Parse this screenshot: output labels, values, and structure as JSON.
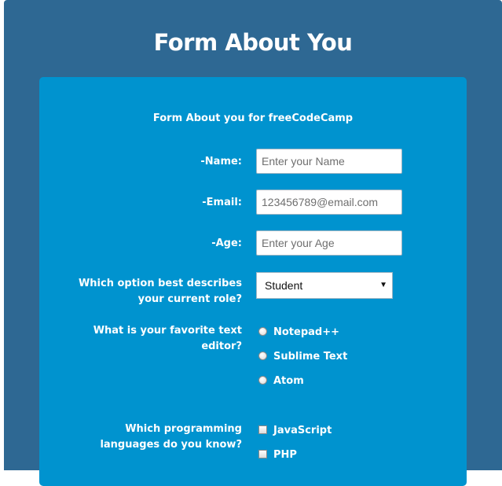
{
  "page": {
    "title": "Form About You"
  },
  "form": {
    "subtitle": "Form About you for freeCodeCamp",
    "name": {
      "label": "-Name:",
      "placeholder": "Enter your Name",
      "value": ""
    },
    "email": {
      "label": "-Email:",
      "placeholder": "123456789@email.com",
      "value": ""
    },
    "age": {
      "label": "-Age:",
      "placeholder": "Enter your Age",
      "value": ""
    },
    "role": {
      "label": "Which option best describes your current role?",
      "selected": "Student"
    },
    "editor": {
      "label": "What is your favorite text editor?",
      "options": [
        "Notepad++",
        "Sublime Text",
        "Atom"
      ]
    },
    "languages": {
      "label": "Which programming languages do you know?",
      "options": [
        "JavaScript",
        "PHP"
      ]
    }
  },
  "colors": {
    "page_background": "#2e6893",
    "card_background": "#0093cf",
    "text": "#ffffff"
  }
}
